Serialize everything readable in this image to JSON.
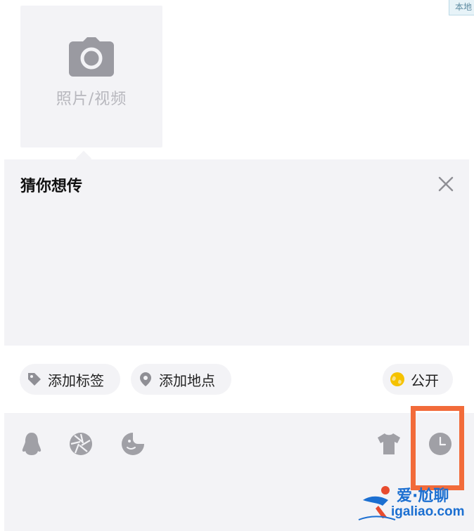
{
  "corner_tag": "本地",
  "media_picker": {
    "label": "照片/视频",
    "icon": "camera-icon"
  },
  "suggestion": {
    "title": "猜你想传",
    "close_icon": "close-icon"
  },
  "chips": {
    "tag": {
      "label": "添加标签",
      "icon": "tag-icon"
    },
    "location": {
      "label": "添加地点",
      "icon": "location-pin-icon"
    },
    "privacy": {
      "label": "公开",
      "icon": "globe-icon"
    }
  },
  "toolbar": {
    "icons": [
      "qq-penguin-icon",
      "aperture-icon",
      "sticker-icon",
      "shirt-icon",
      "clock-icon"
    ]
  },
  "watermark": {
    "top": "爱·尬聊",
    "bottom": "igaliao.com"
  },
  "colors": {
    "panel_bg": "#f3f3f6",
    "highlight": "#f26b3a",
    "watermark_blue": "#1b6fd1",
    "privacy_yellow": "#f5c200"
  }
}
